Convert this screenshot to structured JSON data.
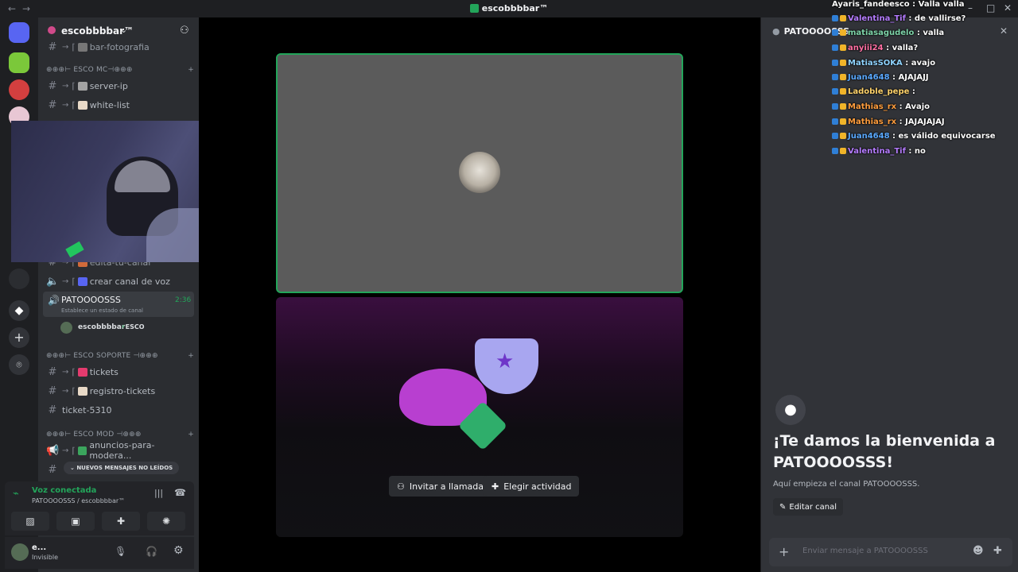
{
  "window": {
    "title": "escobbbbar™"
  },
  "server": {
    "name": "escobbbbar™"
  },
  "channels": {
    "top_partial": "bar-fotografia",
    "cat_mc": "⊕⊕⊕⊢ ESCO MC⊣⊕⊕⊕",
    "server_ip": "server-ip",
    "white_list": "white-list",
    "edita_tu_canal": "edita-tu-canal",
    "crear_canal": "crear canal de voz",
    "voice_channel": "PATOOOOSSS",
    "voice_timer": "2:36",
    "voice_status": "Establece un estado de canal",
    "voice_member": "escobbbbar",
    "voice_member_tag": "ESCO",
    "cat_soporte": "⊕⊕⊕⊢ ESCO SOPORTE ⊣⊕⊕⊕",
    "tickets": "tickets",
    "registro_tickets": "registro-tickets",
    "ticket_5310": "ticket-5310",
    "cat_mod": "⊕⊕⊕⊢ ESCO MOD ⊣⊕⊕⊕",
    "anuncios": "anuncios-para-modera...",
    "unread_pill": "NUEVOS MENSAJES NO LEÍDOS"
  },
  "voice_panel": {
    "status": "Voz conectada",
    "location": "PATOOOOSSS / escobbbbar™"
  },
  "user_panel": {
    "name": "e...",
    "status": "Invisible"
  },
  "stage": {
    "invite_label": "Invitar a llamada",
    "activity_label": "Elegir actividad"
  },
  "chat": {
    "header": "PATOOOOSSS",
    "welcome_title": "¡Te damos la bienvenida a PATOOOOSSS!",
    "welcome_sub": "Aquí empieza el canal PATOOOOSSS.",
    "edit_label": "Editar canal",
    "input_placeholder": "Enviar mensaje a PATOOOOSSS"
  },
  "overlay_chat": [
    {
      "user": "Ayaris_fandeesco",
      "text": "Valla valla",
      "color": "#ffffff"
    },
    {
      "user": "Valentina_Tif",
      "text": "de vallirse?",
      "color": "#b57cff"
    },
    {
      "user": "matiasagudelo",
      "text": "valla",
      "color": "#7dd3a8"
    },
    {
      "user": "anyiii24",
      "text": "valla?",
      "color": "#ff6fa3"
    },
    {
      "user": "MatiasSOKA",
      "text": "avajo",
      "color": "#8fd3ff"
    },
    {
      "user": "Juan4648",
      "text": "AJAJAJJ",
      "color": "#5aa9ff"
    },
    {
      "user": "Ladoble_pepe",
      "text": "",
      "color": "#ffd36b"
    },
    {
      "user": "Mathias_rx",
      "text": "Avajo",
      "color": "#ff9d3d"
    },
    {
      "user": "Mathias_rx",
      "text": "JAJAJAJAJ",
      "color": "#ff9d3d"
    },
    {
      "user": "Juan4648",
      "text": "es válido equivocarse",
      "color": "#5aa9ff"
    },
    {
      "user": "Valentina_Tif",
      "text": "no",
      "color": "#b57cff"
    }
  ]
}
